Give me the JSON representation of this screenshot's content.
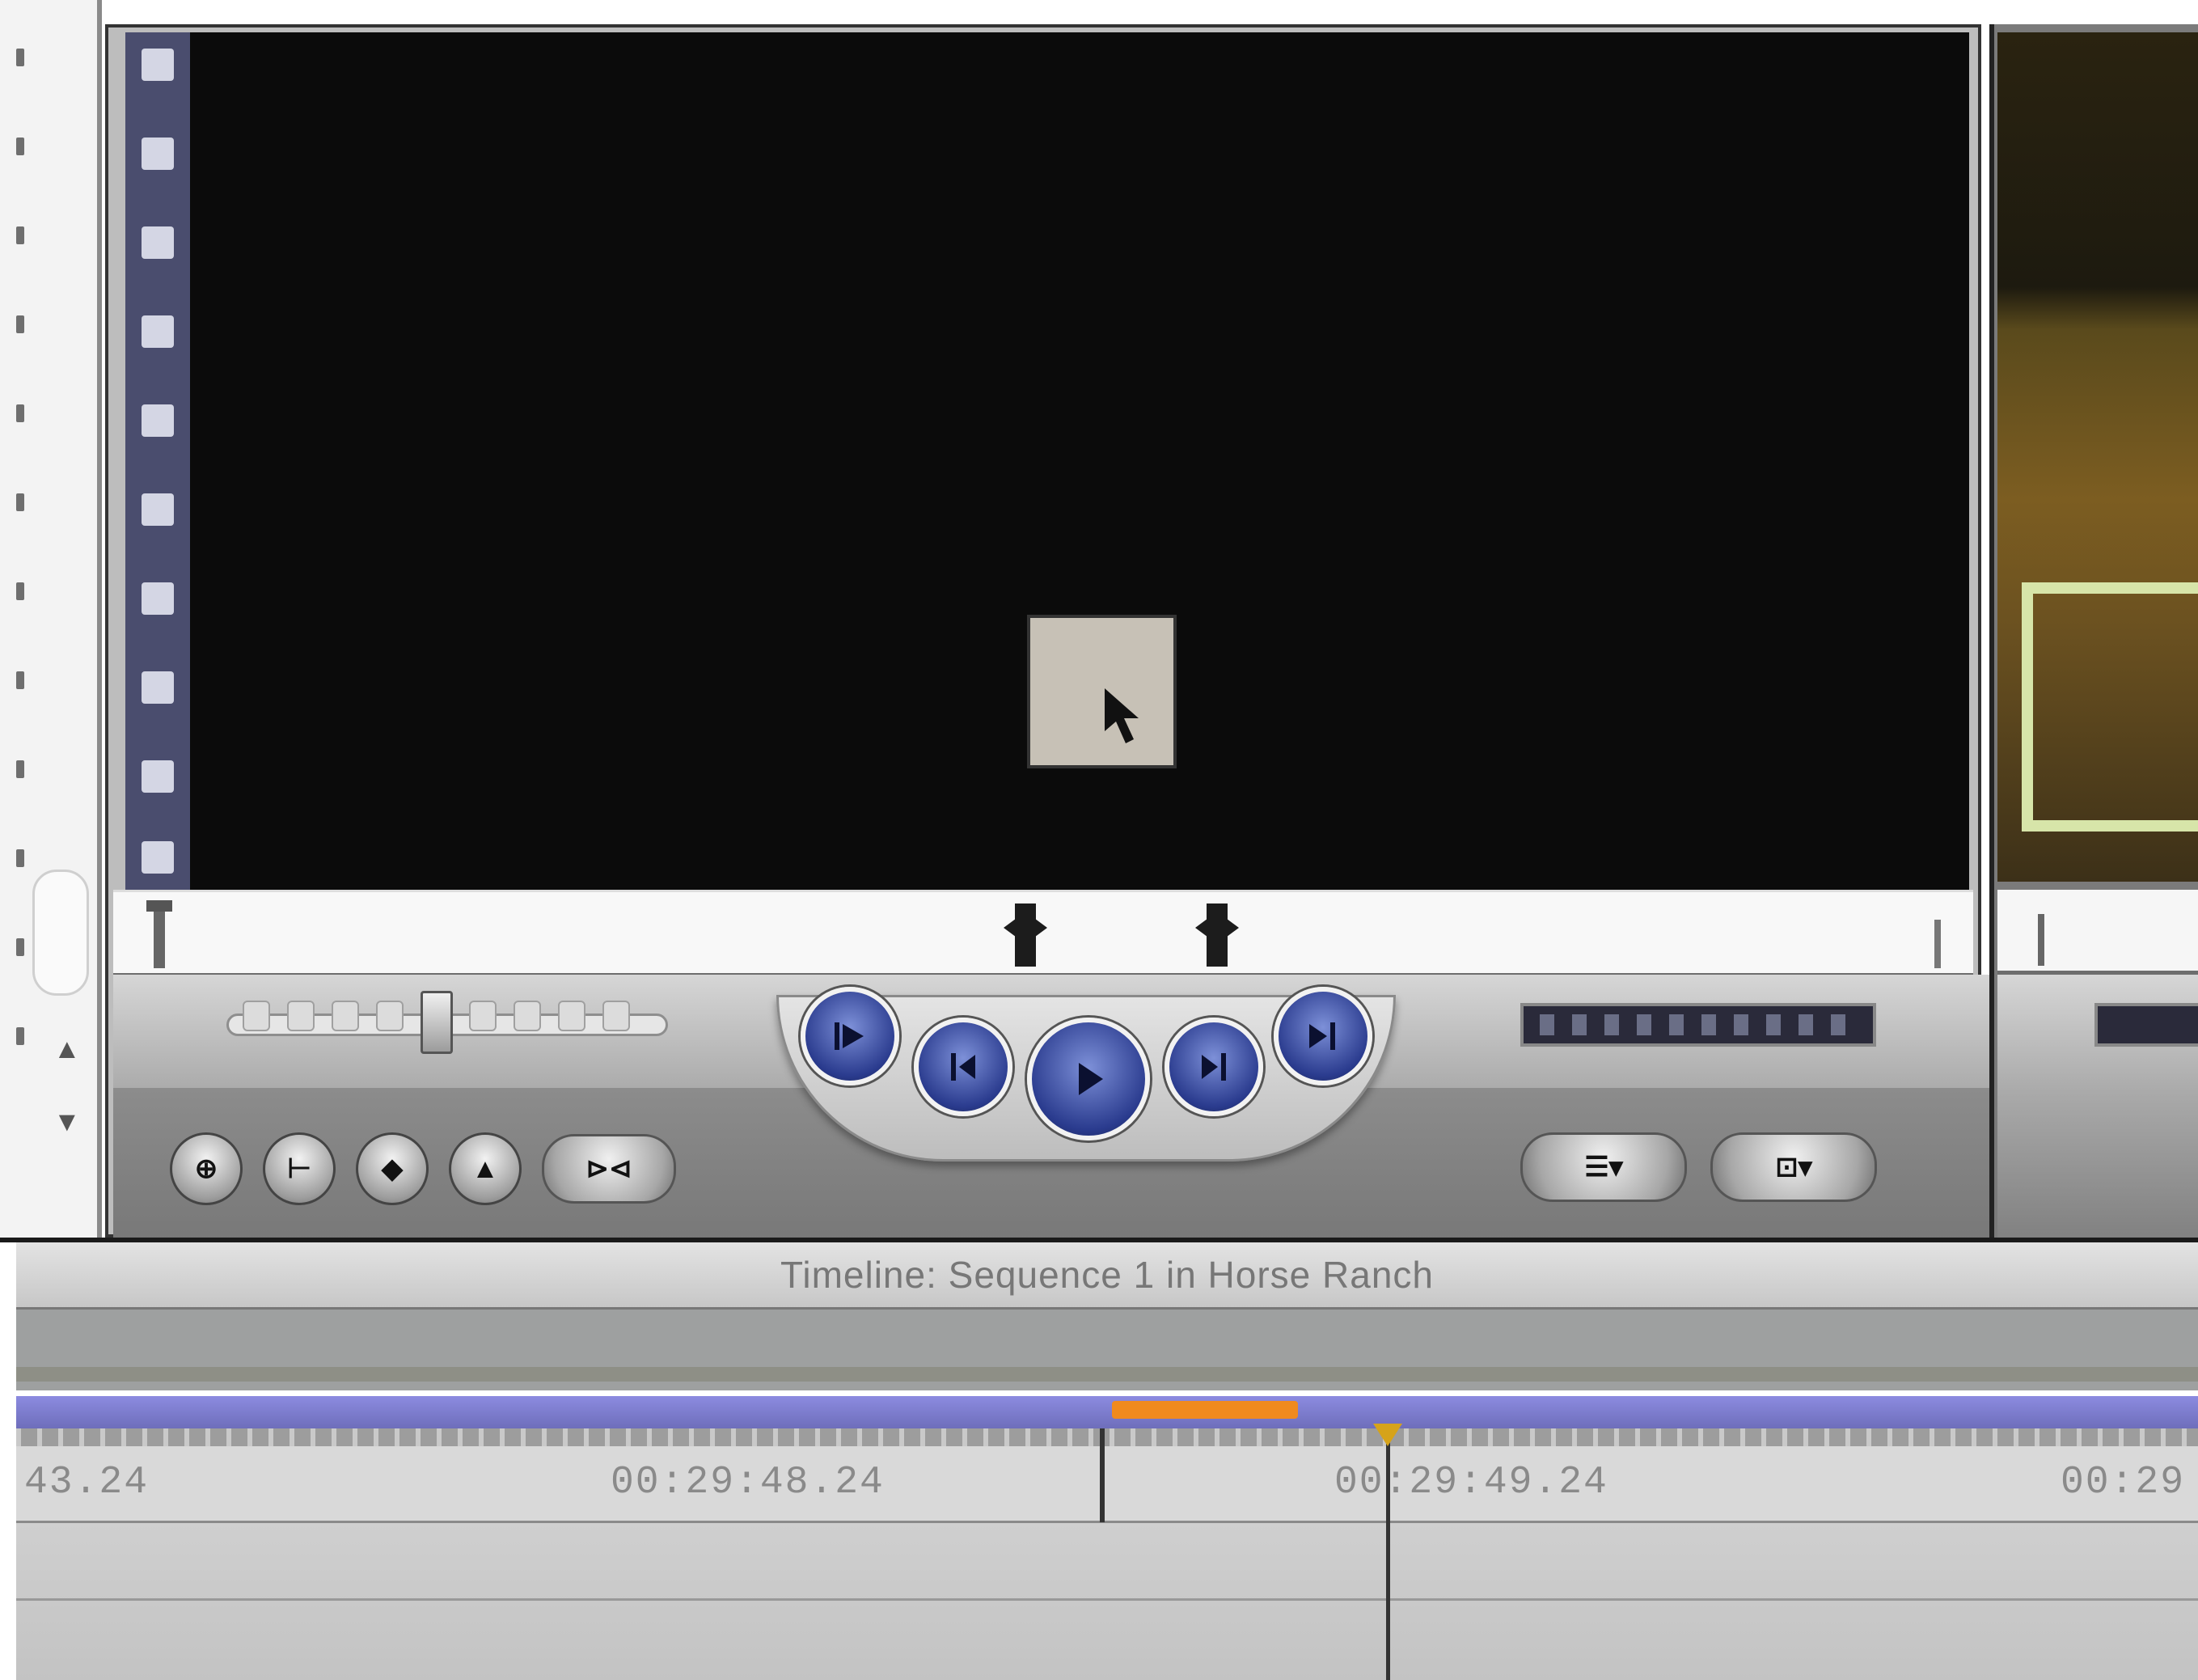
{
  "viewer": {
    "transport": {
      "buttons": [
        {
          "icon": "play-in-to-out-icon"
        },
        {
          "icon": "step-back-icon"
        },
        {
          "icon": "play-icon"
        },
        {
          "icon": "step-forward-icon"
        },
        {
          "icon": "play-around-icon"
        }
      ]
    },
    "edit_buttons": [
      "insert-icon",
      "in-point-icon",
      "marker-icon",
      "keyframe-icon",
      "match-frame-icon"
    ],
    "pill_buttons": [
      "overlay-menu-icon",
      "zoom-menu-icon"
    ]
  },
  "timeline": {
    "title": "Timeline: Sequence 1 in Horse Ranch",
    "timecodes": [
      "43.24",
      "00:29:48.24",
      "00:29:49.24",
      "00:29"
    ]
  },
  "colors": {
    "clip_purple": "#7c7bd0",
    "in_out_orange": "#f08a1e",
    "playhead_yellow": "#d6a31a"
  }
}
